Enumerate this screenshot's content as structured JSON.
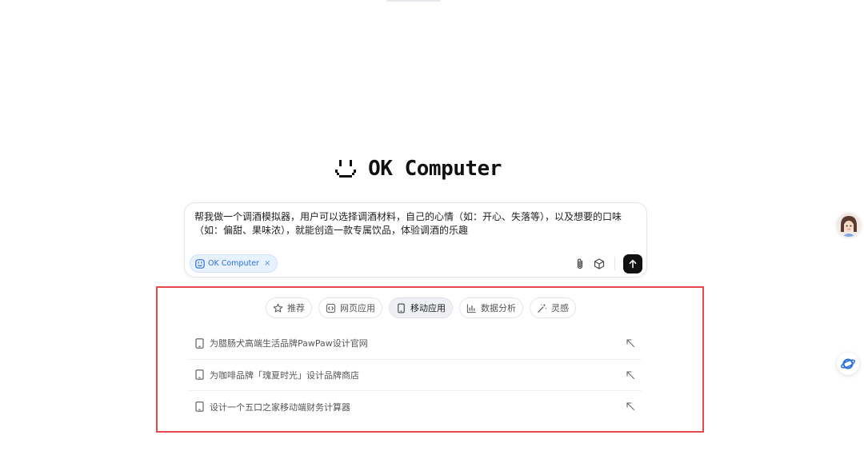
{
  "brand": {
    "name": "OK Computer"
  },
  "composer": {
    "prompt": "帮我做一个调酒模拟器，用户可以选择调酒材料，自己的心情（如：开心、失落等），以及想要的口味（如：偏甜、果味浓），就能创造一款专属饮品，体验调酒的乐趣",
    "mode_chip": {
      "label": "OK Computer",
      "close": "×"
    }
  },
  "tabs": [
    {
      "label": "推荐",
      "icon": "star-icon",
      "active": false
    },
    {
      "label": "网页应用",
      "icon": "code-icon",
      "active": false
    },
    {
      "label": "移动应用",
      "icon": "mobile-icon",
      "active": true
    },
    {
      "label": "数据分析",
      "icon": "bar-chart-icon",
      "active": false
    },
    {
      "label": "灵感",
      "icon": "magic-wand-icon",
      "active": false
    }
  ],
  "suggestions": [
    {
      "text": "为腊肠犬高端生活品牌PawPaw设计官网"
    },
    {
      "text": "为咖啡品牌「瑰夏时光」设计品牌商店"
    },
    {
      "text": "设计一个五口之家移动端财务计算器"
    }
  ],
  "colors": {
    "accent": "#2a6fdb",
    "highlight": "#e5484d",
    "send": "#111111"
  }
}
